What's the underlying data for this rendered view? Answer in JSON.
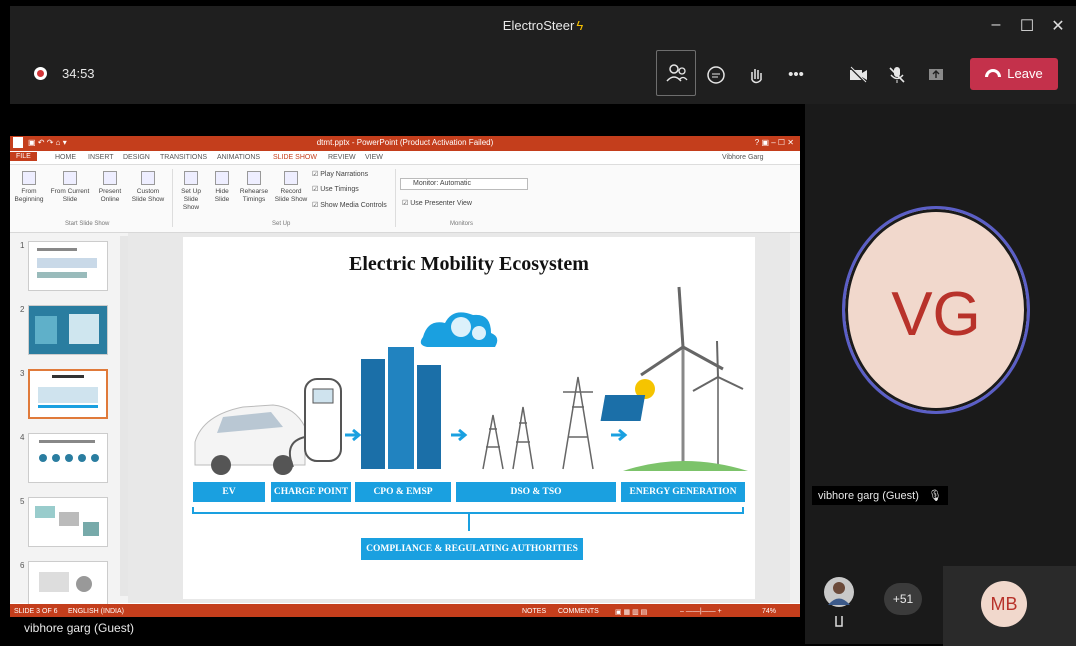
{
  "window": {
    "title": "ElectroSteer",
    "minimize_icon": "minimize-icon",
    "maximize_icon": "maximize-icon",
    "close_icon": "close-icon"
  },
  "toolbar": {
    "timer": "34:53",
    "leave_label": "Leave",
    "icons": [
      "people-icon",
      "chat-icon",
      "raise-hand-icon",
      "more-icon",
      "camera-off-icon",
      "mic-off-icon",
      "share-icon"
    ],
    "colors": {
      "leave": "#c4314b",
      "accent": "#5b5fc7"
    }
  },
  "ppt": {
    "title_bar": "dtmt.pptx - PowerPoint (Product Activation Failed)",
    "tabs": [
      "FILE",
      "HOME",
      "INSERT",
      "DESIGN",
      "TRANSITIONS",
      "ANIMATIONS",
      "SLIDE SHOW",
      "REVIEW",
      "VIEW"
    ],
    "user": "Vibhore Garg",
    "ribbon": {
      "from_beginning": "From Beginning",
      "from_current": "From Current Slide",
      "present_online": "Present Online",
      "custom_show": "Custom Slide Show",
      "group_start": "Start Slide Show",
      "set_up": "Set Up Slide Show",
      "hide_slide": "Hide Slide",
      "rehearse": "Rehearse Timings",
      "record": "Record Slide Show",
      "play_narrations": "Play Narrations",
      "use_timings": "Use Timings",
      "show_media": "Show Media Controls",
      "group_setup": "Set Up",
      "monitor": "Monitor: Automatic",
      "presenter_view": "Use Presenter View",
      "group_monitors": "Monitors"
    },
    "thumb_numbers": [
      "1",
      "2",
      "3",
      "4",
      "5",
      "6"
    ],
    "slide": {
      "title": "Electric Mobility Ecosystem",
      "categories": [
        "EV",
        "CHARGE POINT",
        "CPO & EMSP",
        "DSO & TSO",
        "ENERGY GENERATION"
      ],
      "compliance": "COMPLIANCE & REGULATING AUTHORITIES"
    },
    "status": {
      "slide": "SLIDE 3 OF 6",
      "language": "ENGLISH (INDIA)",
      "notes": "NOTES",
      "comments": "COMMENTS",
      "zoom": "74%"
    }
  },
  "presenter": "vibhore garg (Guest)",
  "participants": {
    "vg_initials": "VG",
    "vg_name": "vibhore garg (Guest)",
    "overflow_count": "+51",
    "mb_initials": "MB"
  }
}
